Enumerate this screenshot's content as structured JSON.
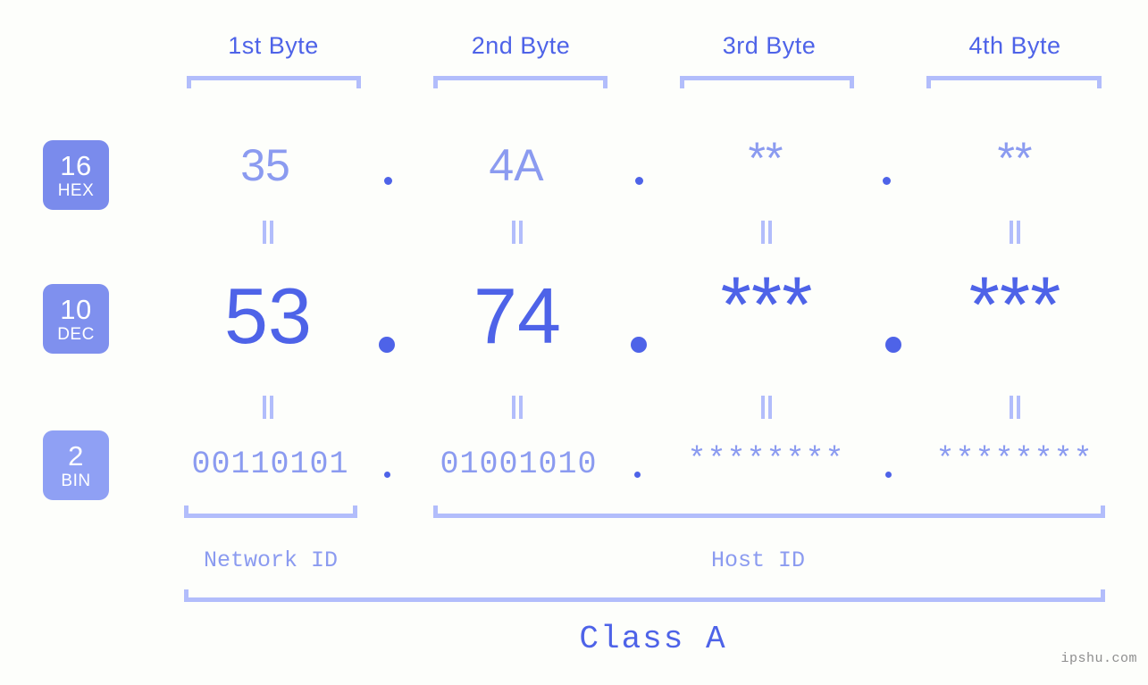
{
  "background_color": "#fdfefb",
  "colors": {
    "accent_strong": "#4e63e8",
    "accent_light": "#8b9bf0",
    "bracket": "#b2bdfb",
    "badge_hex": "#7a8bec",
    "badge_dec": "#7f90ee",
    "badge_bin": "#8fa0f4",
    "watermark": "#8e8e8e"
  },
  "byte_headers": [
    {
      "label": "1st Byte"
    },
    {
      "label": "2nd Byte"
    },
    {
      "label": "3rd Byte"
    },
    {
      "label": "4th Byte"
    }
  ],
  "rows": [
    {
      "radix_number": "16",
      "radix_name": "HEX",
      "values": [
        "35",
        "4A",
        "**",
        "**"
      ],
      "separator": "."
    },
    {
      "radix_number": "10",
      "radix_name": "DEC",
      "values": [
        "53",
        "74",
        "***",
        "***"
      ],
      "separator": "."
    },
    {
      "radix_number": "2",
      "radix_name": "BIN",
      "values": [
        "00110101",
        "01001010",
        "********",
        "********"
      ],
      "separator": "."
    }
  ],
  "equivalence_symbol": "=",
  "sections": [
    {
      "label": "Network ID"
    },
    {
      "label": "Host ID"
    }
  ],
  "class_label": "Class A",
  "watermark": "ipshu.com"
}
